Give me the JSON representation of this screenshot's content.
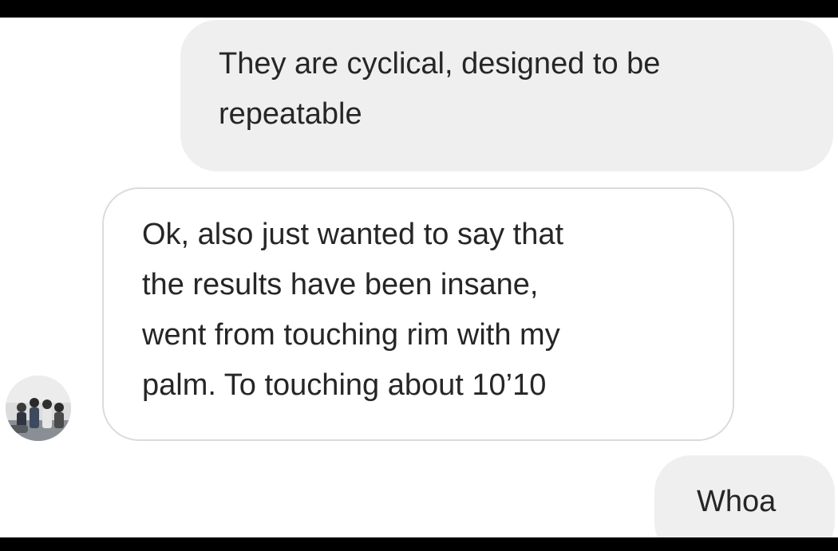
{
  "conversation": {
    "messages": [
      {
        "direction": "outgoing",
        "text": "They are cyclical, designed to be\nrepeatable"
      },
      {
        "direction": "incoming",
        "text": "Ok, also just wanted to say that\nthe results have been insane,\nwent from touching rim with my\npalm. To touching about 10’10"
      },
      {
        "direction": "outgoing",
        "text": "Whoa"
      }
    ],
    "avatar_icon": "group-photo-avatar"
  },
  "colors": {
    "outgoing_bubble": "#efefef",
    "incoming_border": "#dbdbdb",
    "text": "#262626",
    "background": "#ffffff",
    "letterbox": "#000000"
  }
}
